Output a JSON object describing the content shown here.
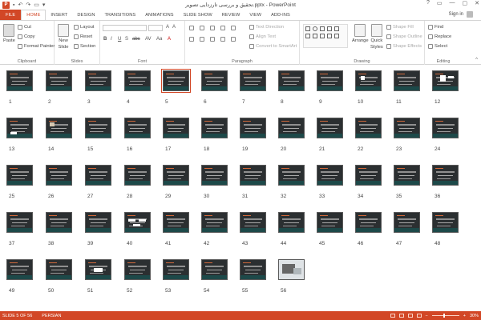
{
  "window": {
    "title": "تحقیق و بررسی تار‌زدایی تصویر.pptx - PowerPoint",
    "app_logo": "P",
    "qat_icons": [
      "save-icon",
      "undo-icon",
      "redo-icon",
      "start-slideshow-icon",
      "customize-qat-icon"
    ],
    "controls": [
      "?",
      "▭",
      "—",
      "▢",
      "✕"
    ]
  },
  "tabs": {
    "items": [
      "FILE",
      "HOME",
      "INSERT",
      "DESIGN",
      "TRANSITIONS",
      "ANIMATIONS",
      "SLIDE SHOW",
      "REVIEW",
      "VIEW",
      "ADD-INS"
    ],
    "active": "HOME",
    "signin": "Sign in"
  },
  "ribbon": {
    "clipboard": {
      "paste": "Paste",
      "cut": "Cut",
      "copy": "Copy",
      "format_painter": "Format Painter",
      "label": "Clipboard"
    },
    "slides": {
      "new_slide": "New",
      "new_slide_2": "Slide",
      "layout": "Layout",
      "reset": "Reset",
      "section": "Section",
      "label": "Slides"
    },
    "font": {
      "label": "Font",
      "buttons": [
        "B",
        "I",
        "U",
        "S",
        "abc",
        "AV",
        "Aa",
        "A"
      ]
    },
    "paragraph": {
      "text_direction": "Text Direction",
      "align_text": "Align Text",
      "convert_smartart": "Convert to SmartArt",
      "label": "Paragraph"
    },
    "drawing": {
      "arrange": "Arrange",
      "quick_styles": "Quick",
      "quick_styles_2": "Styles",
      "shape_fill": "Shape Fill",
      "shape_outline": "Shape Outline",
      "shape_effects": "Shape Effects",
      "label": "Drawing"
    },
    "editing": {
      "find": "Find",
      "replace": "Replace",
      "select": "Select",
      "label": "Editing"
    }
  },
  "slides": [
    "1",
    "2",
    "3",
    "4",
    "5",
    "6",
    "7",
    "8",
    "9",
    "10",
    "11",
    "12",
    "13",
    "14",
    "15",
    "16",
    "17",
    "18",
    "19",
    "20",
    "21",
    "22",
    "23",
    "24",
    "25",
    "26",
    "27",
    "28",
    "29",
    "30",
    "31",
    "32",
    "33",
    "34",
    "35",
    "36",
    "37",
    "38",
    "39",
    "40",
    "41",
    "42",
    "43",
    "44",
    "45",
    "46",
    "47",
    "48",
    "49",
    "50",
    "51",
    "52",
    "53",
    "54",
    "55",
    "56"
  ],
  "selected_slide": "5",
  "status": {
    "slide_position": "SLIDE 5 OF 56",
    "language": "PERSIAN",
    "zoom": "30%"
  },
  "colors": {
    "accent": "#d24726",
    "slide_bg": "#2b2f31"
  }
}
